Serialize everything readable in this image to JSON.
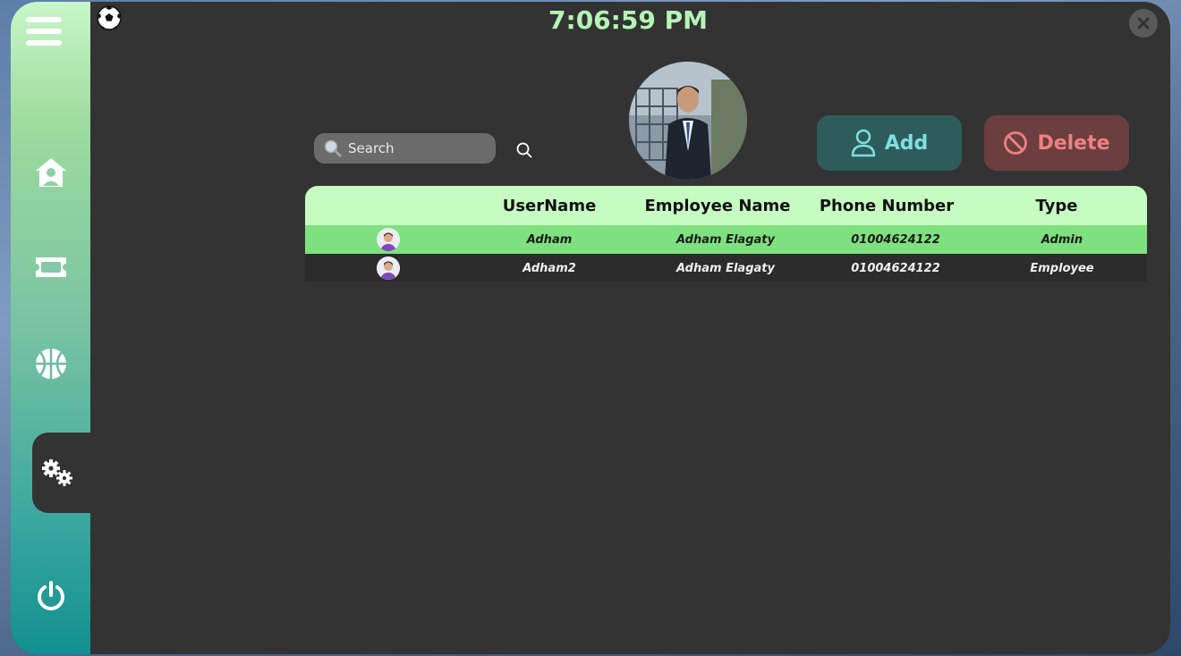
{
  "clock": "7:06:59 PM",
  "search": {
    "placeholder": "Search"
  },
  "actions": {
    "add_label": "Add",
    "delete_label": "Delete"
  },
  "sidebar": {
    "items": [
      {
        "icon": "home-user-icon"
      },
      {
        "icon": "ticket-icon"
      },
      {
        "icon": "basketball-icon"
      },
      {
        "icon": "settings-gears-icon",
        "active": true
      },
      {
        "icon": "power-icon"
      }
    ]
  },
  "table": {
    "columns": [
      "",
      "UserName",
      "Employee Name",
      "Phone Number",
      "Type"
    ],
    "rows": [
      {
        "username": "Adham",
        "employee_name": "Adham Elagaty",
        "phone": "01004624122",
        "type": "Admin",
        "selected": true
      },
      {
        "username": "Adham2",
        "employee_name": "Adham Elagaty",
        "phone": "01004624122",
        "type": "Employee",
        "selected": false
      }
    ]
  },
  "colors": {
    "clock": "#b5f5b5",
    "header_bg": "#c6fbc1",
    "selected_row": "#7fe07f",
    "add_button": "#2e5c5c",
    "delete_button": "#6b3f3f"
  }
}
